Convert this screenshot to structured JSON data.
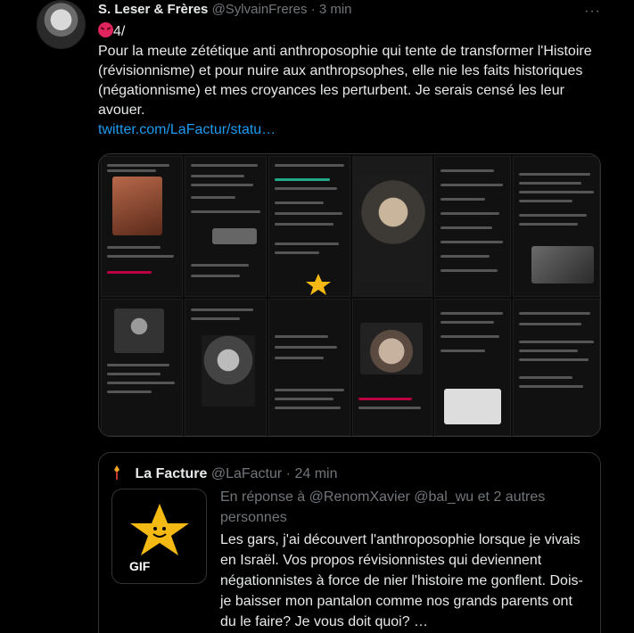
{
  "tweet": {
    "author_name": "S. Leser & Frères",
    "author_handle": "@SylvainFreres",
    "dot": "·",
    "time": "3 min",
    "more": "···",
    "emoji_icon": "angry-face-emoji",
    "text_prefix": "4/",
    "text": "Pour la meute zététique anti anthroposophie qui tente de transformer l'Histoire (révisionnisme) et pour nuire aux anthropsophes, elle nie les faits historiques (négationnisme) et mes croyances les perturbent. Je serais censé les leur avouer.",
    "link": "twitter.com/LaFactur/statu…"
  },
  "quote": {
    "name": "La Facture",
    "handle": "@LaFactur",
    "dot": "·",
    "time": "24 min",
    "gif_label": "GIF",
    "reply_prefix": "En réponse à",
    "reply_mentions": "@RenomXavier @bal_wu",
    "reply_suffix": "et 2 autres personnes",
    "text": "Les gars, j'ai découvert l'anthroposophie lorsque je vivais en Israël. Vos propos révisionnistes qui deviennent négationnistes à force de nier l'histoire me gonflent. Dois-je baisser mon pantalon comme nos grands parents ont du le faire? Je vous doit quoi? …"
  },
  "colors": {
    "background": "#000000",
    "text": "#e7e9ea",
    "muted": "#71767b",
    "link": "#1d9bf0",
    "border": "#2f3336",
    "star": "#f5b914"
  }
}
